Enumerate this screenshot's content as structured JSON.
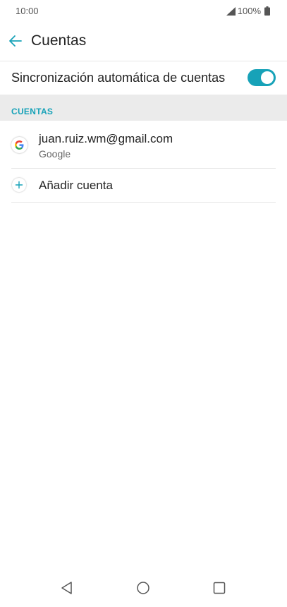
{
  "status_bar": {
    "time": "10:00",
    "battery": "100%"
  },
  "header": {
    "title": "Cuentas",
    "back_icon": "arrow-left-icon"
  },
  "auto_sync": {
    "label": "Sincronización automática de cuentas",
    "enabled": true
  },
  "section": {
    "title": "CUENTAS"
  },
  "accounts": [
    {
      "email": "juan.ruiz.wm@gmail.com",
      "type": "Google",
      "icon": "google-icon"
    }
  ],
  "add_account": {
    "label": "Añadir cuenta",
    "icon": "plus-icon"
  },
  "nav_bar": {
    "back_icon": "triangle-back-icon",
    "home_icon": "circle-home-icon",
    "recents_icon": "square-recents-icon"
  },
  "colors": {
    "accent": "#17a2b8",
    "section_bg": "#ebebeb",
    "google_blue": "#4285f4"
  }
}
